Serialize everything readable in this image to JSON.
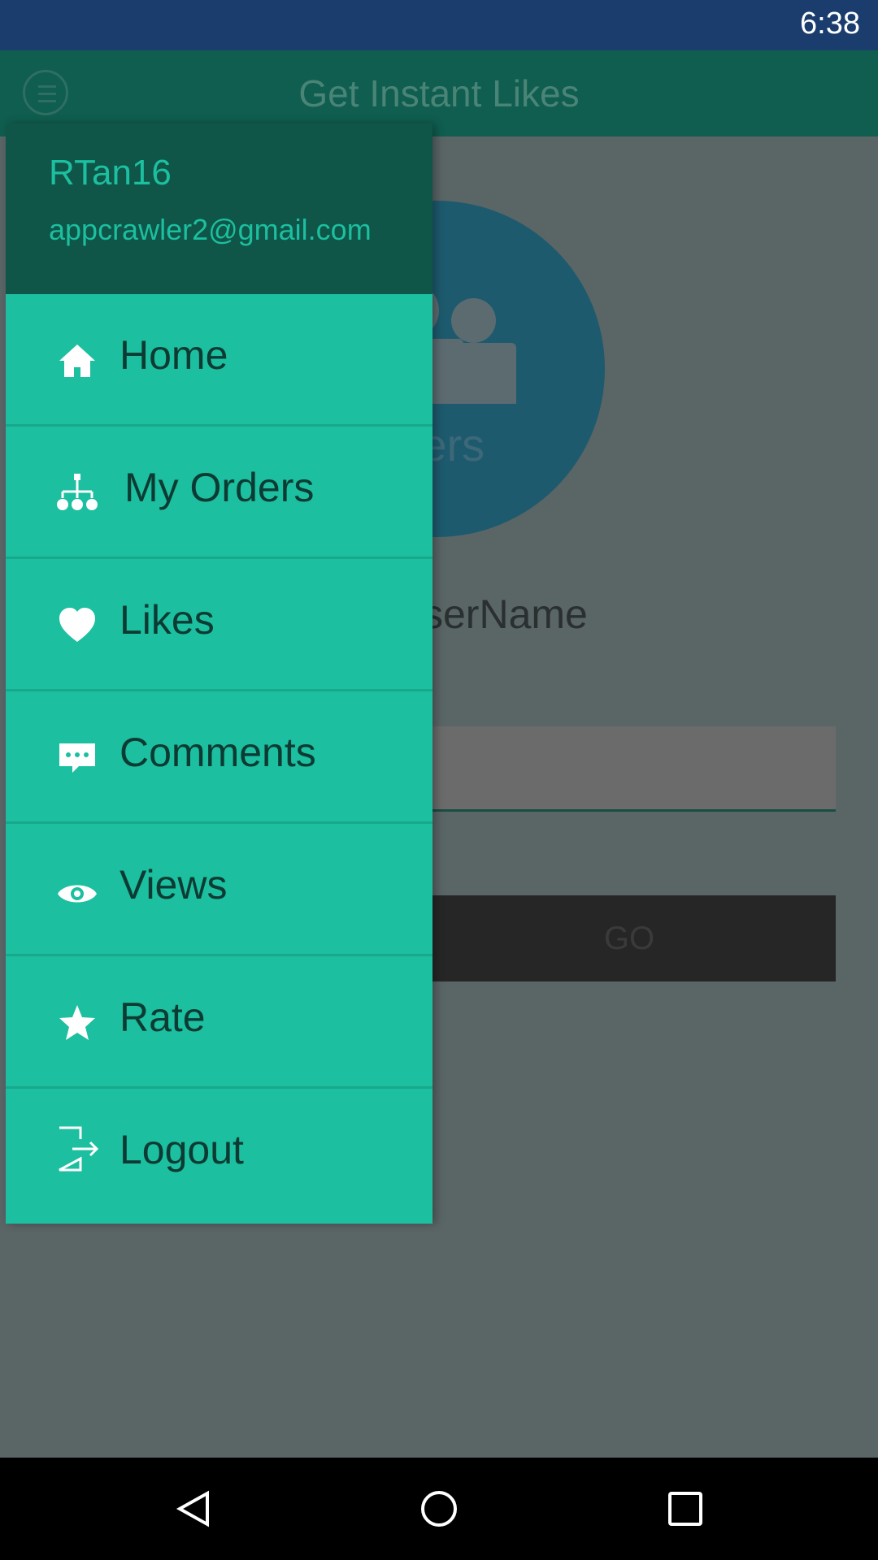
{
  "status_bar": {
    "time": "6:38"
  },
  "app": {
    "title": "Get Instant Likes",
    "followers_label": "wers",
    "username_label": "serName",
    "go_label": "GO"
  },
  "drawer": {
    "username": "RTan16",
    "email": "appcrawler2@gmail.com",
    "items": [
      {
        "label": "Home",
        "icon": "home-icon"
      },
      {
        "label": "My Orders",
        "icon": "hierarchy-icon"
      },
      {
        "label": "Likes",
        "icon": "heart-icon"
      },
      {
        "label": "Comments",
        "icon": "comment-icon"
      },
      {
        "label": "Views",
        "icon": "eye-icon"
      },
      {
        "label": "Rate",
        "icon": "star-icon"
      },
      {
        "label": "Logout",
        "icon": "logout-icon"
      }
    ]
  },
  "colors": {
    "drawer_bg": "#1cbf9f",
    "drawer_header_bg": "#0f5548",
    "toolbar_bg": "#0f5e4f"
  }
}
